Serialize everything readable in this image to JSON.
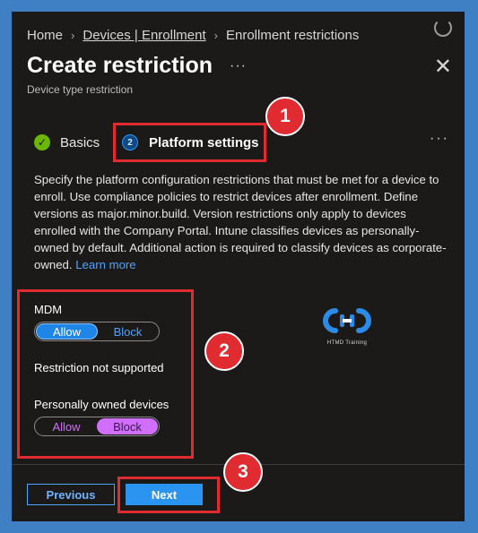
{
  "breadcrumb": {
    "home": "Home",
    "devices": "Devices | Enrollment",
    "current": "Enrollment restrictions"
  },
  "header": {
    "title": "Create restriction",
    "more": "···",
    "close": "✕",
    "subtitle": "Device type restriction"
  },
  "tabs": [
    {
      "label": "Basics",
      "status": "complete"
    },
    {
      "label": "Platform settings",
      "step": "2",
      "status": "active"
    }
  ],
  "tabs_more": "···",
  "description": {
    "text": "Specify the platform configuration restrictions that must be met for a device to enroll. Use compliance policies to restrict devices after enrollment. Define versions as major.minor.build. Version restrictions only apply to devices enrolled with the Company Portal. Intune classifies devices as personally-owned by default. Additional action is required to classify devices as corporate-owned.",
    "link": "Learn more"
  },
  "settings": {
    "mdm": {
      "label": "MDM",
      "allow": "Allow",
      "block": "Block",
      "selected": "Allow"
    },
    "restriction_note": "Restriction not supported",
    "personal": {
      "label": "Personally owned devices",
      "allow": "Allow",
      "block": "Block",
      "selected": "Block"
    }
  },
  "logo": {
    "text": "HTMD Training",
    "icon": "htmd-logo-icon"
  },
  "footer": {
    "previous": "Previous",
    "next": "Next"
  },
  "callouts": [
    "1",
    "2",
    "3"
  ],
  "colors": {
    "accent": "#2b93f0",
    "highlight": "#e02b30",
    "block_toggle": "#d16ffc",
    "success": "#6bb700"
  }
}
